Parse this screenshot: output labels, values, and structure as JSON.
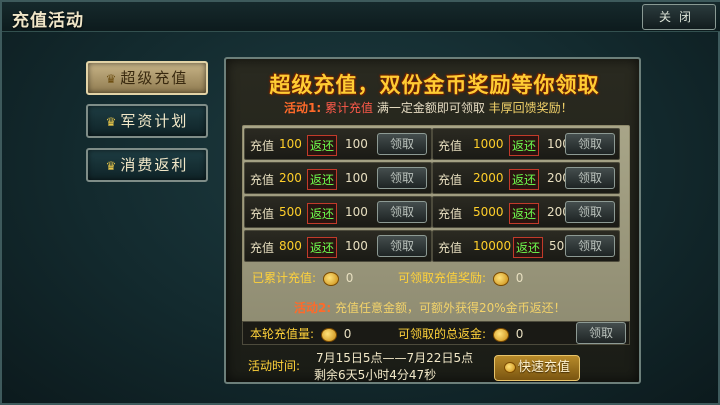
{
  "window": {
    "title": "充值活动",
    "close_label": "关闭"
  },
  "sidebar": {
    "items": [
      {
        "label": "超级充值",
        "active": true
      },
      {
        "label": "军资计划",
        "active": false
      },
      {
        "label": "消费返利",
        "active": false
      }
    ]
  },
  "panel": {
    "headline": "超级充值，双份金币奖励等你领取",
    "activity1": {
      "tag": "活动1:",
      "red": "累计充值",
      "white": "满一定金额即可领取",
      "gold": "丰厚回馈奖励！"
    },
    "tiers": [
      {
        "label": "充值",
        "amount": "100",
        "return_label": "返还",
        "return_value": "100",
        "claim": "领取"
      },
      {
        "label": "充值",
        "amount": "1000",
        "return_label": "返还",
        "return_value": "100",
        "claim": "领取"
      },
      {
        "label": "充值",
        "amount": "200",
        "return_label": "返还",
        "return_value": "100",
        "claim": "领取"
      },
      {
        "label": "充值",
        "amount": "2000",
        "return_label": "返还",
        "return_value": "200",
        "claim": "领取"
      },
      {
        "label": "充值",
        "amount": "500",
        "return_label": "返还",
        "return_value": "100",
        "claim": "领取"
      },
      {
        "label": "充值",
        "amount": "5000",
        "return_label": "返还",
        "return_value": "200",
        "claim": "领取"
      },
      {
        "label": "充值",
        "amount": "800",
        "return_label": "返还",
        "return_value": "100",
        "claim": "领取"
      },
      {
        "label": "充值",
        "amount": "10000",
        "return_label": "返还",
        "return_value": "500",
        "claim": "领取"
      }
    ],
    "summary1": {
      "cumulative_label": "已累计充值:",
      "cumulative_value": "0",
      "reward_label": "可领取充值奖励:",
      "reward_value": "0"
    },
    "activity2": {
      "tag": "活动2:",
      "text": "充值任意金额，可额外获得20%金币返还！"
    },
    "summary2": {
      "round_label": "本轮充值量:",
      "round_value": "0",
      "refund_label": "可领取的总返金:",
      "refund_value": "0",
      "claim": "领取"
    },
    "time": {
      "label": "活动时间:",
      "range": "7月15日5点——7月22日5点",
      "remaining": "剩余6天5小时4分47秒"
    },
    "quick_recharge": "快速充值"
  }
}
